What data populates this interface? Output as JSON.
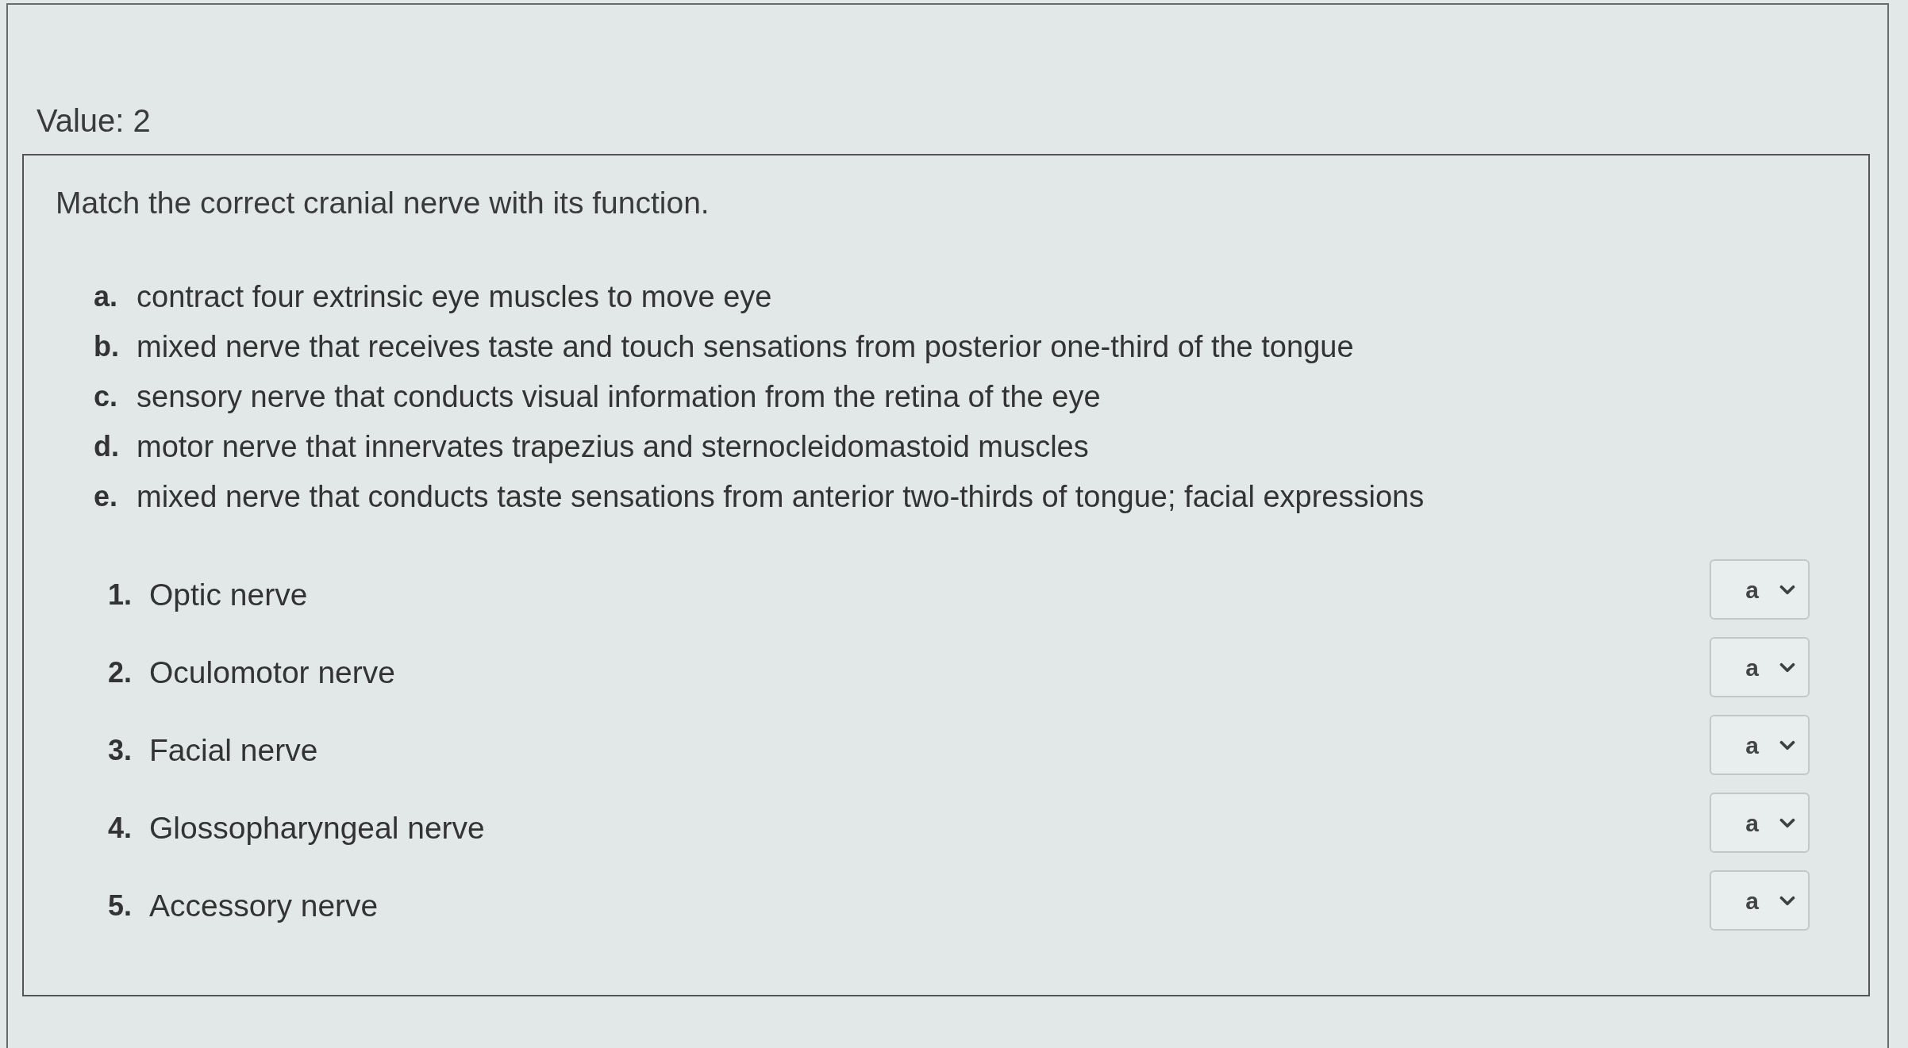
{
  "value_label": "Value: 2",
  "question": {
    "prompt": "Match the correct cranial nerve with its function.",
    "options": [
      {
        "letter": "a.",
        "text": "contract four extrinsic eye muscles to move eye"
      },
      {
        "letter": "b.",
        "text": "mixed nerve that receives taste and touch sensations from posterior one-third of the tongue"
      },
      {
        "letter": "c.",
        "text": "sensory nerve that conducts visual information from the retina of the eye"
      },
      {
        "letter": "d.",
        "text": "motor nerve that innervates trapezius and sternocleidomastoid muscles"
      },
      {
        "letter": "e.",
        "text": "mixed nerve that conducts taste sensations from anterior two-thirds of tongue; facial expressions"
      }
    ],
    "items": [
      {
        "number": "1.",
        "text": "Optic nerve",
        "answer": "a"
      },
      {
        "number": "2.",
        "text": "Oculomotor nerve",
        "answer": "a"
      },
      {
        "number": "3.",
        "text": "Facial nerve",
        "answer": "a"
      },
      {
        "number": "4.",
        "text": "Glossopharyngeal nerve",
        "answer": "a"
      },
      {
        "number": "5.",
        "text": "Accessory nerve",
        "answer": "a"
      }
    ]
  }
}
